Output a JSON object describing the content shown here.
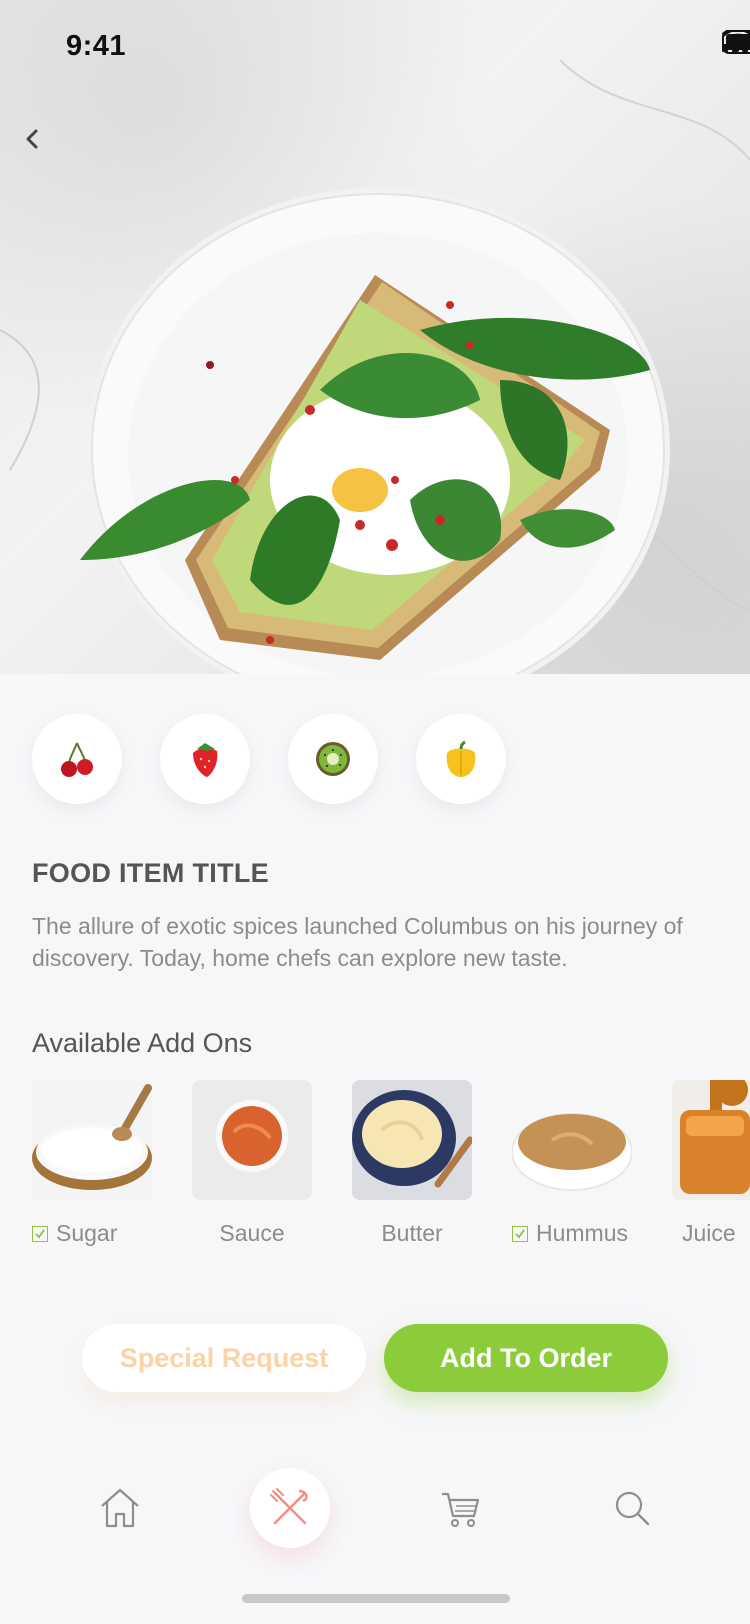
{
  "status_bar": {
    "time": "9:41"
  },
  "navigation": {
    "back_icon": "chevron-left-icon"
  },
  "hero": {
    "image": "avocado-toast-with-poached-egg-and-spinach"
  },
  "ingredients": [
    {
      "name": "cherry-icon"
    },
    {
      "name": "strawberry-icon"
    },
    {
      "name": "kiwi-icon"
    },
    {
      "name": "bell-pepper-icon"
    }
  ],
  "item": {
    "title": "FOOD ITEM TITLE",
    "description": "The allure of exotic spices launched Columbus on his journey of discovery. Today, home chefs can explore new taste."
  },
  "addons": {
    "title": "Available Add Ons",
    "items": [
      {
        "label": "Sugar",
        "checked": true
      },
      {
        "label": "Sauce",
        "checked": false
      },
      {
        "label": "Butter",
        "checked": false
      },
      {
        "label": "Hummus",
        "checked": true
      },
      {
        "label": "Juice",
        "checked": false
      }
    ]
  },
  "actions": {
    "special_request": "Special Request",
    "add_to_order": "Add To Order"
  },
  "tabbar": {
    "items": [
      {
        "icon": "home-icon",
        "active": false
      },
      {
        "icon": "fork-knife-icon",
        "active": true
      },
      {
        "icon": "cart-icon",
        "active": false
      },
      {
        "icon": "search-icon",
        "active": false
      }
    ]
  },
  "colors": {
    "accent_green": "#8ccc3a",
    "special_text": "#fbd3a6",
    "active_tab": "#f28b82"
  }
}
